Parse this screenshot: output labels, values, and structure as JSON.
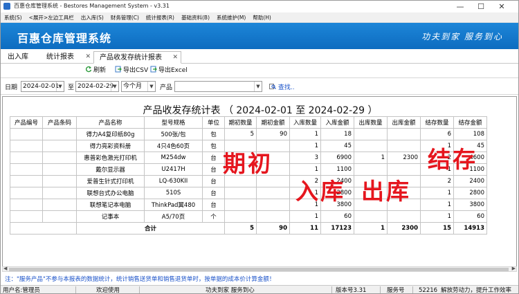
{
  "window": {
    "title": "百惠仓库管理系统 - Bestores Management System - v3.31",
    "minimize": "—",
    "maximize": "☐",
    "close": "✕"
  },
  "menu": [
    "系统(S)",
    "<展开>左边工具栏",
    "出入库(S)",
    "财务管理(C)",
    "统计报表(R)",
    "基础资料(B)",
    "系统维护(M)",
    "帮助(H)"
  ],
  "banner": {
    "brand": "百惠仓库管理系统",
    "slogan": "功夫到家 服务到心"
  },
  "tabs": [
    {
      "label": "出入库",
      "closable": false
    },
    {
      "label": "统计报表",
      "closable": true
    },
    {
      "label": "产品收发存统计报表",
      "closable": true,
      "active": true
    }
  ],
  "toolbar": {
    "refresh": "刷新",
    "export_csv": "导出CSV",
    "export_excel": "导出Excel"
  },
  "filter": {
    "date_label": "日期",
    "start_date": "2024-02-01",
    "to_label": "至",
    "end_date": "2024-02-29",
    "period": "今个月",
    "product_label": "产品",
    "product_value": "",
    "search_label": "查找.."
  },
  "report": {
    "title": "产品收发存统计表 （ 2024-02-01  至  2024-02-29 ）",
    "columns": [
      "产品编号",
      "产品条码",
      "产品名称",
      "型号规格",
      "单位",
      "期初数量",
      "期初金额",
      "入库数量",
      "入库金额",
      "出库数量",
      "出库金额",
      "结存数量",
      "结存金额"
    ],
    "rows": [
      [
        "",
        "",
        "得力A4复印纸80g",
        "500张/包",
        "包",
        "5",
        "90",
        "1",
        "18",
        "",
        "",
        "6",
        "108"
      ],
      [
        "",
        "",
        "得力亮彩资料册",
        "4只4色60页",
        "包",
        "",
        "",
        "1",
        "45",
        "",
        "",
        "1",
        "45"
      ],
      [
        "",
        "",
        "惠普彩色激光打印机",
        "M254dw",
        "台",
        "",
        "",
        "3",
        "6900",
        "1",
        "2300",
        "2",
        "4600"
      ],
      [
        "",
        "",
        "戴尔显示器",
        "U2417H",
        "台",
        "",
        "",
        "1",
        "1100",
        "",
        "",
        "1",
        "1100"
      ],
      [
        "",
        "",
        "爱普生针式打印机",
        "LQ-630KII",
        "台",
        "",
        "",
        "2",
        "2400",
        "",
        "",
        "2",
        "2400"
      ],
      [
        "",
        "",
        "联想台式办公电脑",
        "510S",
        "台",
        "",
        "",
        "1",
        "2800",
        "",
        "",
        "1",
        "2800"
      ],
      [
        "",
        "",
        "联想笔记本电脑",
        "ThinkPad翼480",
        "台",
        "",
        "",
        "1",
        "3800",
        "",
        "",
        "1",
        "3800"
      ],
      [
        "",
        "",
        "记事本",
        "A5/70页",
        "个",
        "",
        "",
        "1",
        "60",
        "",
        "",
        "1",
        "60"
      ]
    ],
    "total": {
      "label": "合计",
      "values": [
        "5",
        "90",
        "11",
        "17123",
        "1",
        "2300",
        "15",
        "14913"
      ]
    }
  },
  "overlays": {
    "opening": "期初",
    "inbound": "入库",
    "outbound": "出库",
    "closing": "结存"
  },
  "note": "注：\"服务产品\"不参与本报表的数据统计，统计销售送货单和销售退货单时，按单据的成本价计算金额！",
  "status": {
    "user": "用户名:管理员",
    "welcome": "欢迎使用",
    "slogan": "功夫到家 服务到心",
    "version": "版本号3.31",
    "service_label": "服务号",
    "service_no": "52216",
    "motto": "解放劳动力，提升工作效率"
  }
}
